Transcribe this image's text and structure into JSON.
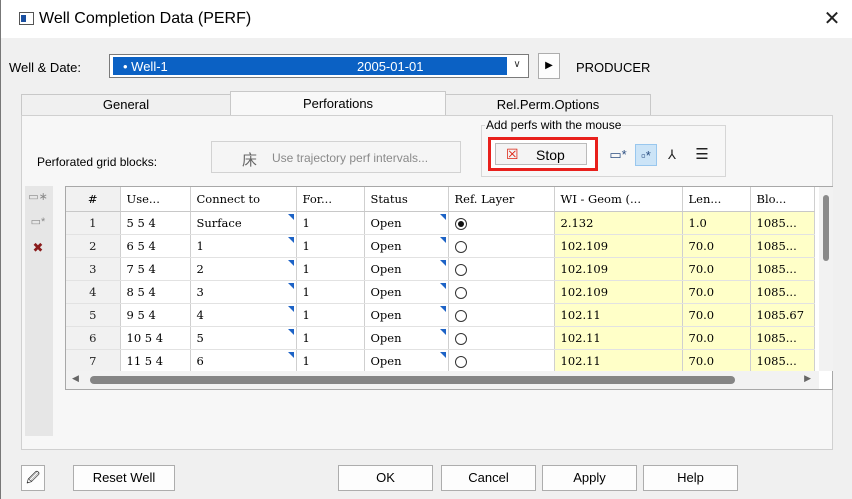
{
  "window": {
    "title": "Well Completion Data (PERF)",
    "close": "✕"
  },
  "well": {
    "label": "Well & Date:",
    "name": "Well-1",
    "date": "2005-01-01",
    "type": "PRODUCER"
  },
  "tabs": [
    "General",
    "Perforations",
    "Rel.Perm.Options"
  ],
  "active_tab": "Perforations",
  "perforations": {
    "grid_label": "Perforated grid blocks:",
    "trajectory_button": "Use trajectory perf intervals...",
    "mouse_group_label": "Add perfs with the mouse",
    "stop_button": "Stop"
  },
  "grid": {
    "columns": [
      "#",
      "Use...",
      "Connect to",
      "For...",
      "Status",
      "Ref. Layer",
      "WI - Geom (...",
      "Len...",
      "Blo..."
    ],
    "rows": [
      {
        "num": "1",
        "use": "5 5 4",
        "connect": "Surface",
        "for": "1",
        "status": "Open",
        "ref": true,
        "wi": "2.132",
        "len": "1.0",
        "blo": "1085..."
      },
      {
        "num": "2",
        "use": "6 5 4",
        "connect": "1",
        "for": "1",
        "status": "Open",
        "ref": false,
        "wi": "102.109",
        "len": "70.0",
        "blo": "1085..."
      },
      {
        "num": "3",
        "use": "7 5 4",
        "connect": "2",
        "for": "1",
        "status": "Open",
        "ref": false,
        "wi": "102.109",
        "len": "70.0",
        "blo": "1085..."
      },
      {
        "num": "4",
        "use": "8 5 4",
        "connect": "3",
        "for": "1",
        "status": "Open",
        "ref": false,
        "wi": "102.109",
        "len": "70.0",
        "blo": "1085..."
      },
      {
        "num": "5",
        "use": "9 5 4",
        "connect": "4",
        "for": "1",
        "status": "Open",
        "ref": false,
        "wi": "102.11",
        "len": "70.0",
        "blo": "1085.67"
      },
      {
        "num": "6",
        "use": "10 5 4",
        "connect": "5",
        "for": "1",
        "status": "Open",
        "ref": false,
        "wi": "102.11",
        "len": "70.0",
        "blo": "1085..."
      },
      {
        "num": "7",
        "use": "11 5 4",
        "connect": "6",
        "for": "1",
        "status": "Open",
        "ref": false,
        "wi": "102.11",
        "len": "70.0",
        "blo": "1085..."
      }
    ]
  },
  "buttons": {
    "reset": "Reset Well",
    "ok": "OK",
    "cancel": "Cancel",
    "apply": "Apply",
    "help": "Help"
  },
  "colors": {
    "selection": "#0b61c4",
    "highlight_border": "#e8201c",
    "yellow_cells": "#ffffc8"
  }
}
